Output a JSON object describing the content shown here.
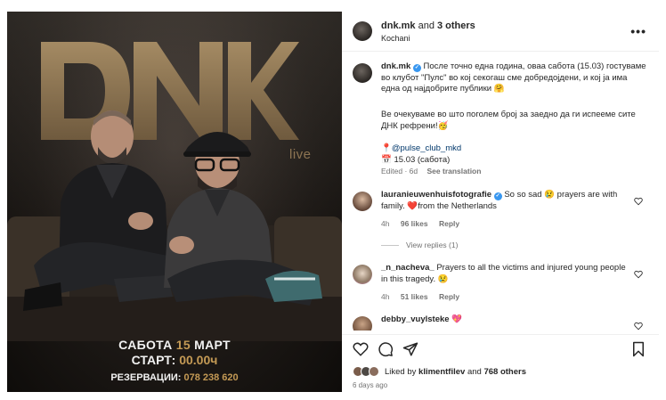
{
  "poster": {
    "logo_text": "DNK",
    "logo_sub": "live",
    "date_prefix": "САБОТА",
    "date_num": "15",
    "date_month": "МАРТ",
    "start_label": "СТАРТ:",
    "start_time": "00.00ч",
    "reserve_label": "РЕЗЕРВАЦИИ:",
    "reserve_phone": "078 238 620"
  },
  "header": {
    "username": "dnk.mk",
    "and_text": "and",
    "others": "3 others",
    "location": "Kochani",
    "more_icon": "more-icon"
  },
  "caption": {
    "username": "dnk.mk",
    "p1": "После точно една година, оваа сабота (15.03) гостуваме во клубот \"Пулс\" во кој секогаш сме добредојдени, и кој ја има една од најдобрите публики 🤗",
    "p2": "Ве очекуваме во што поголем број за заедно да ги испееме сите ДНК рефрени!🥳",
    "pin": "📍",
    "club": "@pulse_club_mkd",
    "cal": "📅",
    "date": "15.03 (сабота)",
    "edited": "Edited · 6d",
    "see_translation": "See translation"
  },
  "comments": [
    {
      "username": "lauranieuwenhuisfotografie",
      "text": "So so sad 😢 prayers are with family. ❤️from the Netherlands",
      "time": "4h",
      "likes": "96 likes",
      "reply": "Reply",
      "view_replies": "View replies (1)"
    },
    {
      "username": "_n_nacheva_",
      "text": "Prayers to all the victims and injured young people in this tragedy. 😢",
      "time": "4h",
      "likes": "51 likes",
      "reply": "Reply"
    },
    {
      "username": "debby_vuylsteke",
      "text": "💖"
    }
  ],
  "footer": {
    "liked_by": "Liked by",
    "liker": "klimentfilev",
    "and_text": "and",
    "others": "768 others",
    "time": "6 days ago"
  },
  "colors": {
    "verified": "#3897f0",
    "link": "#00376b",
    "poster_accent": "#c49a55",
    "logo": "#8d7452"
  }
}
